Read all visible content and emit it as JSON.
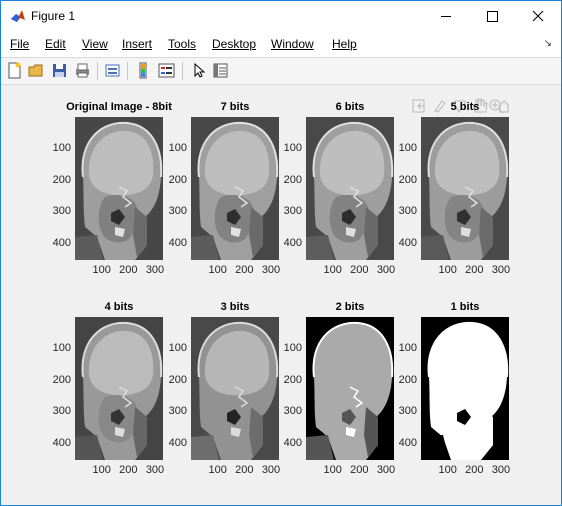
{
  "window": {
    "title": "Figure 1"
  },
  "menu": [
    "File",
    "Edit",
    "View",
    "Insert",
    "Tools",
    "Desktop",
    "Window",
    "Help"
  ],
  "panels": [
    {
      "title": "Original Image - 8bit",
      "bits": 8
    },
    {
      "title": "7 bits",
      "bits": 7
    },
    {
      "title": "6 bits",
      "bits": 6
    },
    {
      "title": "5 bits",
      "bits": 5
    },
    {
      "title": "4 bits",
      "bits": 4
    },
    {
      "title": "3 bits",
      "bits": 3
    },
    {
      "title": "2 bits",
      "bits": 2
    },
    {
      "title": "1 bits",
      "bits": 1
    }
  ],
  "yticks": [
    "100",
    "200",
    "300",
    "400"
  ],
  "xticks": [
    "100",
    "200",
    "300"
  ],
  "colors": {
    "frame_border": "#1883d7",
    "figure_bg": "#f0f0f0"
  }
}
